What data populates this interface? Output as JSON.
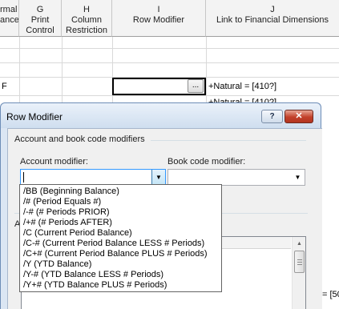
{
  "spreadsheet": {
    "columns": [
      {
        "letter": "",
        "name_line1": "rmal",
        "name_line2": "ance"
      },
      {
        "letter": "G",
        "name_line1": "Print",
        "name_line2": "Control"
      },
      {
        "letter": "H",
        "name_line1": "Column",
        "name_line2": "Restriction"
      },
      {
        "letter": "I",
        "name_line1": "Row Modifier",
        "name_line2": ""
      },
      {
        "letter": "J",
        "name_line1": "Link to Financial Dimensions",
        "name_line2": ""
      }
    ],
    "row_label_f": "F",
    "cell_button_label": "...",
    "link_cell_1": "+Natural = [410?]",
    "link_cell_2": "+Natural = [410?]",
    "link_cell_bottom": "= [50"
  },
  "dialog": {
    "title": "Row Modifier",
    "help_label": "?",
    "close_label": "✕",
    "section_title": "Account and book code modifiers",
    "account_modifier_label": "Account modifier:",
    "account_modifier_value": "",
    "book_code_modifier_label": "Book code modifier:",
    "book_code_modifier_value": "",
    "section2_fragment": "A",
    "account_modifier_options": [
      "/BB (Beginning Balance)",
      "/# (Period Equals #)",
      "/-# (# Periods PRIOR)",
      "/+# (# Periods AFTER)",
      "/C (Current Period Balance)",
      "/C-# (Current Period Balance LESS # Periods)",
      "/C+# (Current Period Balance PLUS # Periods)",
      "/Y (YTD Balance)",
      "/Y-# (YTD Balance LESS # Periods)",
      "/Y+# (YTD Balance PLUS # Periods)"
    ]
  },
  "icons": {
    "dropdown_arrow": "chevron-down-icon",
    "scroll_up": "scroll-up-arrow-icon"
  }
}
